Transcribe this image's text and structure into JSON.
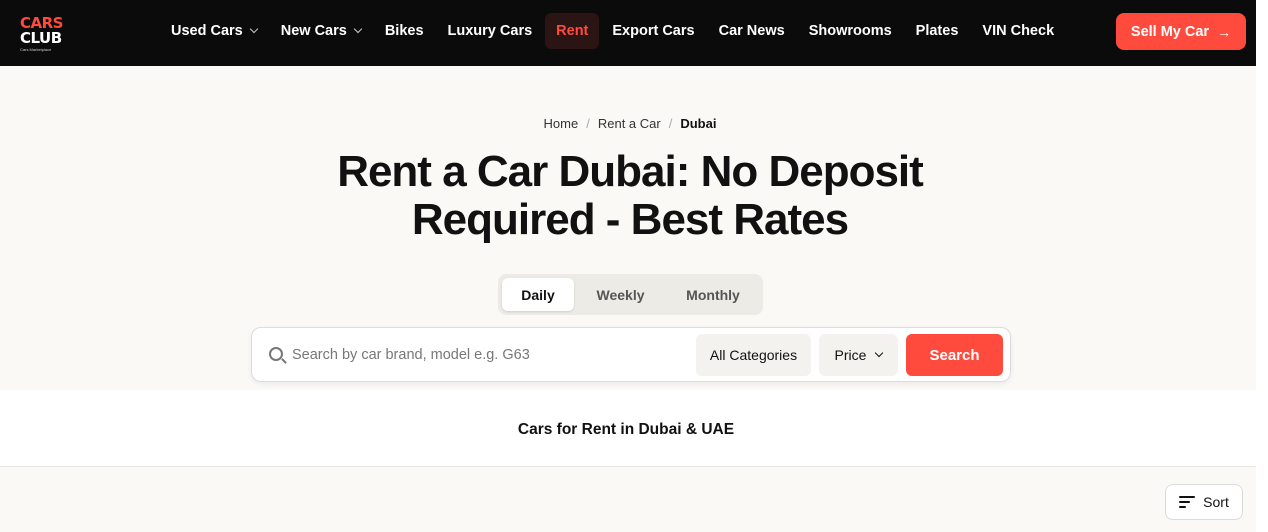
{
  "logo": {
    "line1": "CARS",
    "line2": "CLUB",
    "tagline": "Cars Marketplace"
  },
  "nav": {
    "items": [
      {
        "label": "Used Cars",
        "dropdown": true
      },
      {
        "label": "New Cars",
        "dropdown": true
      },
      {
        "label": "Bikes"
      },
      {
        "label": "Luxury Cars"
      },
      {
        "label": "Rent",
        "active": true
      },
      {
        "label": "Export Cars"
      },
      {
        "label": "Car News"
      },
      {
        "label": "Showrooms"
      },
      {
        "label": "Plates"
      },
      {
        "label": "VIN Check"
      }
    ],
    "sell_label": "Sell My Car",
    "sell_arrow": "→"
  },
  "breadcrumb": {
    "items": [
      "Home",
      "Rent a Car"
    ],
    "current": "Dubai",
    "separator": "/"
  },
  "page_title": {
    "line1": "Rent a Car Dubai: No Deposit",
    "line2": "Required - Best Rates"
  },
  "period_tabs": {
    "items": [
      "Daily",
      "Weekly",
      "Monthly"
    ],
    "active": "Daily"
  },
  "search": {
    "placeholder": "Search by car brand, model e.g. G63",
    "category_label": "All Categories",
    "price_label": "Price",
    "button_label": "Search"
  },
  "section": {
    "title": "Cars for Rent in Dubai & UAE"
  },
  "sort": {
    "label": "Sort"
  },
  "colors": {
    "accent": "#ff4b3e",
    "nav_bg": "#0b0b0b",
    "hero_bg": "#faf9f6"
  }
}
